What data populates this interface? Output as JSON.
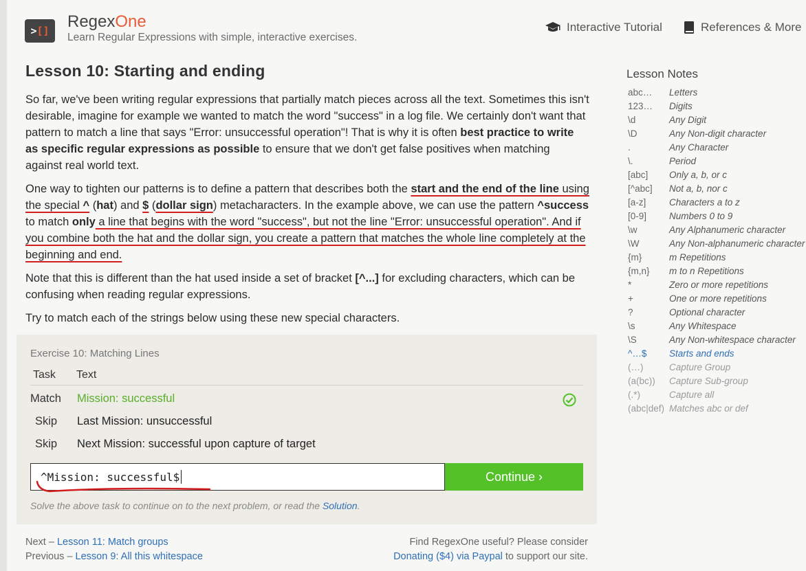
{
  "header": {
    "logo": {
      "text_left": ">",
      "text_bracket": "[]"
    },
    "brand_regex": "Regex",
    "brand_one": "One",
    "tagline": "Learn Regular Expressions with simple, interactive exercises.",
    "nav": {
      "tutorial": "Interactive Tutorial",
      "references": "References & More"
    }
  },
  "lesson": {
    "title": "Lesson 10: Starting and ending",
    "p1": {
      "a": "So far, we've been writing regular expressions that partially match pieces across all the text. Sometimes this isn't desirable, imagine for example we wanted to match the word \"success\" in a log file. We certainly don't want that pattern to match a line that says \"Error: unsuccessful operation\"! That is why it is often ",
      "b": "best practice to write as specific regular expressions as possible",
      "c": " to ensure that we don't get false positives when matching against real world text."
    },
    "p2": {
      "t1": "One way to tighten our patterns is to define a pattern that describes both the ",
      "b1": "start and the end of the line",
      "t2": " using the special ",
      "b2": "^",
      "t3": " (",
      "b3": "hat",
      "t4": ") and ",
      "b4": "$",
      "t5": " (",
      "b5": "dollar sign",
      "t6": ") metacharacters. In the example above, we can use the pattern ",
      "b6": "^success",
      "t7": " to match ",
      "b7": "only",
      "t8": " a line that begins with the word \"success\", but not the line \"Error: unsuccessful operation\". ",
      "t9": "And if you combine both the hat and the dollar sign, you create a pattern that matches the whole line completely at the beginning and end."
    },
    "p3": {
      "a": "Note that this is different than the hat used inside a set of bracket ",
      "b": "[^...]",
      "c": " for excluding characters, which can be confusing when reading regular expressions."
    },
    "p4": "Try to match each of the strings below using these new special characters."
  },
  "notes": {
    "title": "Lesson Notes",
    "items": [
      {
        "key": "abc…",
        "val": "Letters"
      },
      {
        "key": "123…",
        "val": "Digits"
      },
      {
        "key": "\\d",
        "val": "Any Digit"
      },
      {
        "key": "\\D",
        "val": "Any Non-digit character"
      },
      {
        "key": ".",
        "val": "Any Character"
      },
      {
        "key": "\\.",
        "val": "Period"
      },
      {
        "key": "[abc]",
        "val": "Only a, b, or c"
      },
      {
        "key": "[^abc]",
        "val": "Not a, b, nor c"
      },
      {
        "key": "[a-z]",
        "val": "Characters a to z"
      },
      {
        "key": "[0-9]",
        "val": "Numbers 0 to 9"
      },
      {
        "key": "\\w",
        "val": "Any Alphanumeric character"
      },
      {
        "key": "\\W",
        "val": "Any Non-alphanumeric character"
      },
      {
        "key": "{m}",
        "val": "m Repetitions"
      },
      {
        "key": "{m,n}",
        "val": "m to n Repetitions"
      },
      {
        "key": "*",
        "val": "Zero or more repetitions"
      },
      {
        "key": "+",
        "val": "One or more repetitions"
      },
      {
        "key": "?",
        "val": "Optional character"
      },
      {
        "key": "\\s",
        "val": "Any Whitespace"
      },
      {
        "key": "\\S",
        "val": "Any Non-whitespace character"
      },
      {
        "key": "^…$",
        "val": "Starts and ends"
      },
      {
        "key": "(…)",
        "val": "Capture Group"
      },
      {
        "key": "(a(bc))",
        "val": "Capture Sub-group"
      },
      {
        "key": "(.*)",
        "val": "Capture all"
      },
      {
        "key": "(abc|def)",
        "val": "Matches abc or def"
      }
    ]
  },
  "exercise": {
    "title": "Exercise 10: Matching Lines",
    "col_task": "Task",
    "col_text": "Text",
    "rows": [
      {
        "task": "Match",
        "text": "Mission: successful"
      },
      {
        "task": "Skip",
        "text": "Last Mission: unsuccessful"
      },
      {
        "task": "Skip",
        "text": "Next Mission: successful upon capture of target"
      }
    ],
    "input_value": "^Mission: successful$",
    "continue_label": "Continue ›",
    "hint_prefix": "Solve the above task to continue on to the next problem, or read the ",
    "hint_link": "Solution",
    "hint_suffix": "."
  },
  "footer": {
    "next_prefix": "Next – ",
    "next_link": "Lesson 11: Match groups",
    "prev_prefix": "Previous – ",
    "prev_link": "Lesson 9: All this whitespace",
    "donate_line1": "Find RegexOne useful? Please consider",
    "donate_link": "Donating ($4) via Paypal",
    "donate_suffix": " to support our site."
  },
  "colors": {
    "accent_orange": "#e95b38",
    "success_green": "#54c129",
    "link_blue": "#2f6fb8",
    "annotation_red": "#d21e1e"
  }
}
